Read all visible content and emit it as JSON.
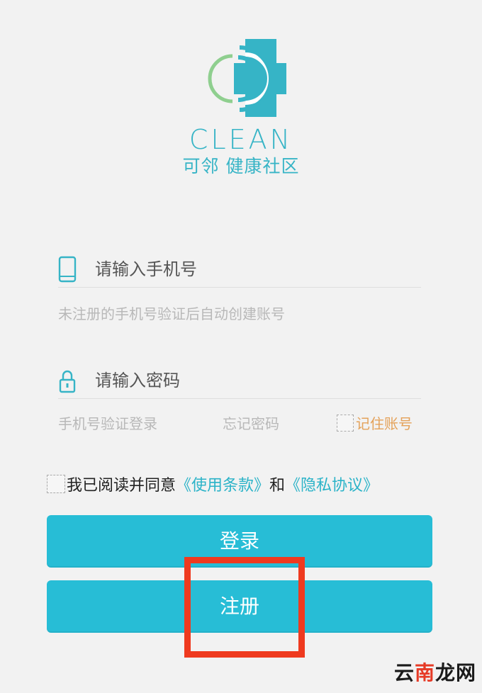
{
  "logo": {
    "brand_text": "CLEAN",
    "subtitle": "可邻 健康社区",
    "primary_color": "#36b4c6",
    "accent_color": "#8fcf8f",
    "icon": "clean-cross-logo"
  },
  "phone_field": {
    "placeholder": "请输入手机号",
    "icon": "phone-icon"
  },
  "phone_hint": "未注册的手机号验证后自动创建账号",
  "password_field": {
    "placeholder": "请输入密码",
    "icon": "lock-icon"
  },
  "links": {
    "phone_login": "手机号验证登录",
    "forgot_password": "忘记密码",
    "remember_account": "记住账号"
  },
  "agreement": {
    "prefix": "我已阅读并同意",
    "terms": "《使用条款》",
    "conjunction": "和",
    "privacy": "《隐私协议》"
  },
  "buttons": {
    "login": "登录",
    "register": "注册",
    "color": "#27bdd6"
  },
  "annotation": {
    "highlight_color": "#ef3a1f"
  },
  "watermark": {
    "part1": "云",
    "part2": "南",
    "part3": "龙网"
  }
}
